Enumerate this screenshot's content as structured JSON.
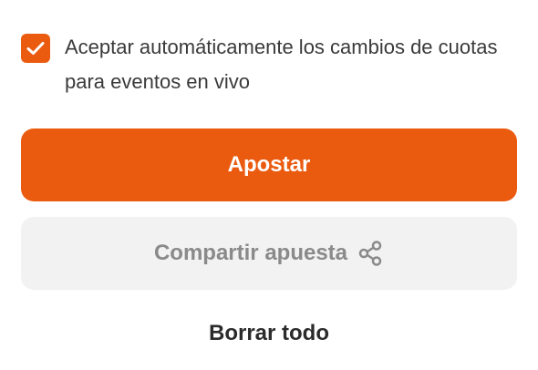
{
  "accept_odds": {
    "checked": true,
    "label": "Aceptar automáticamente los cambios de cuotas para eventos en vivo",
    "checkbox_icon": "checkmark-icon"
  },
  "actions": {
    "bet_label": "Apostar",
    "share_label": "Compartir apuesta",
    "share_icon": "share-icon",
    "clear_label": "Borrar todo"
  },
  "colors": {
    "accent": "#ea5b10",
    "secondary_bg": "#f2f2f2",
    "secondary_text": "#8a8a8a",
    "text": "#3a3a3a"
  }
}
